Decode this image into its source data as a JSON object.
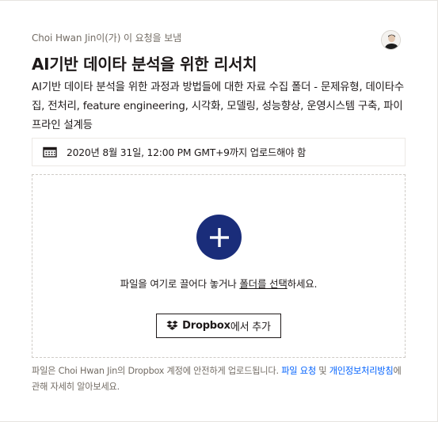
{
  "request": {
    "requester_name": "Choi Hwan Jin",
    "requester_suffix": "이(가) 이 요청을 보냄",
    "title": "AI기반 데이타 분석을 위한 리서치",
    "description": "AI기반 데이타 분석을 위한 과정과 방법들에 대한 자료 수집 폴더 - 문제유형, 데이타수집, 전처리, feature engineering, 시각화, 모델링, 성능향상, 운영시스템 구축, 파이프라인 설계등"
  },
  "deadline": {
    "icon": "calendar-icon",
    "text": "2020년 8월 31일, 12:00 PM GMT+9까지 업로드해야 함"
  },
  "dropzone": {
    "add_icon": "plus-icon",
    "accent_color": "#1a2d7a",
    "message_prefix": "파일을 여기로 끌어다 놓거나 ",
    "message_link": "폴더를 선택",
    "message_suffix": "하세요.",
    "dropbox_button_bold": "Dropbox",
    "dropbox_button_suffix": "에서 추가"
  },
  "footer": {
    "text_prefix": "파일은 Choi Hwan Jin의 Dropbox 계정에 안전하게 업로드됩니다. ",
    "link_file_request": "파일 요청",
    "text_and": " 및 ",
    "link_privacy": "개인정보처리방침",
    "text_suffix": "에 관해 자세히 알아보세요.",
    "link_color": "#0061fe"
  }
}
